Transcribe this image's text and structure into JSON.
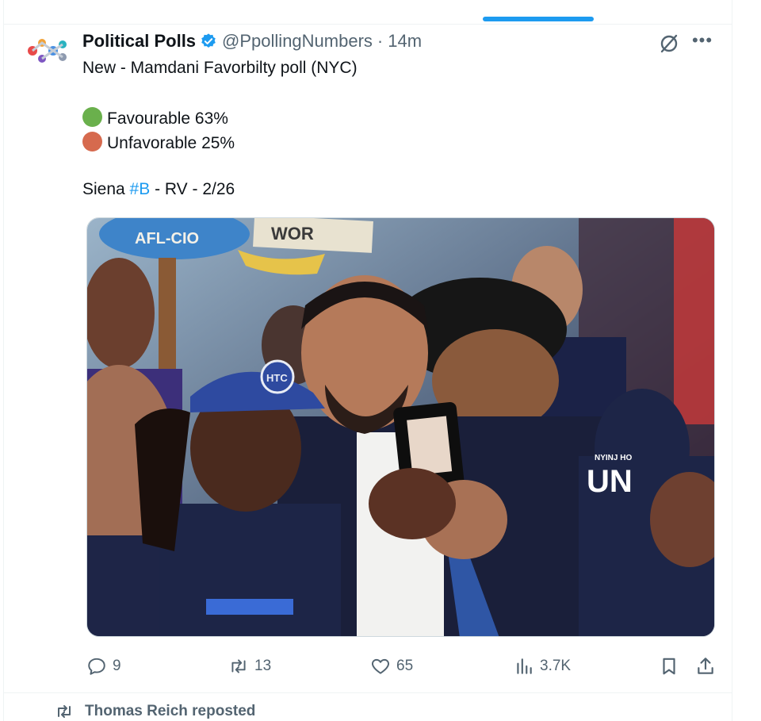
{
  "tweet": {
    "author_name": "Political Polls",
    "author_handle": "@PpollingNumbers",
    "separator": "·",
    "time": "14m",
    "line1": "New - Mamdani Favorbilty poll (NYC)",
    "items": [
      {
        "label": "Favourable 63%",
        "color": "#6ab04c"
      },
      {
        "label": "Unfavorable 25%",
        "color": "#d66a4e"
      }
    ],
    "source_prefix": "Siena ",
    "source_hashtag": "#B",
    "source_suffix": " - RV - 2/26",
    "photo_sign_left": "AFL-CIO",
    "photo_sign_right": "WOR",
    "photo_cap_logo": "HTC",
    "photo_shirt_text": "UN",
    "photo_shirt_small": "NYINJ HO"
  },
  "actions": {
    "reply_count": "9",
    "retweet_count": "13",
    "like_count": "65",
    "views_count": "3.7K"
  },
  "next_item": {
    "repost_text": "Thomas Reich reposted"
  },
  "colors": {
    "accent": "#1d9bf0",
    "secondary_text": "#536471"
  },
  "icons": [
    "verified-badge-icon",
    "grok-icon",
    "more-icon",
    "reply-icon",
    "retweet-icon",
    "like-icon",
    "views-icon",
    "bookmark-icon",
    "share-icon"
  ]
}
